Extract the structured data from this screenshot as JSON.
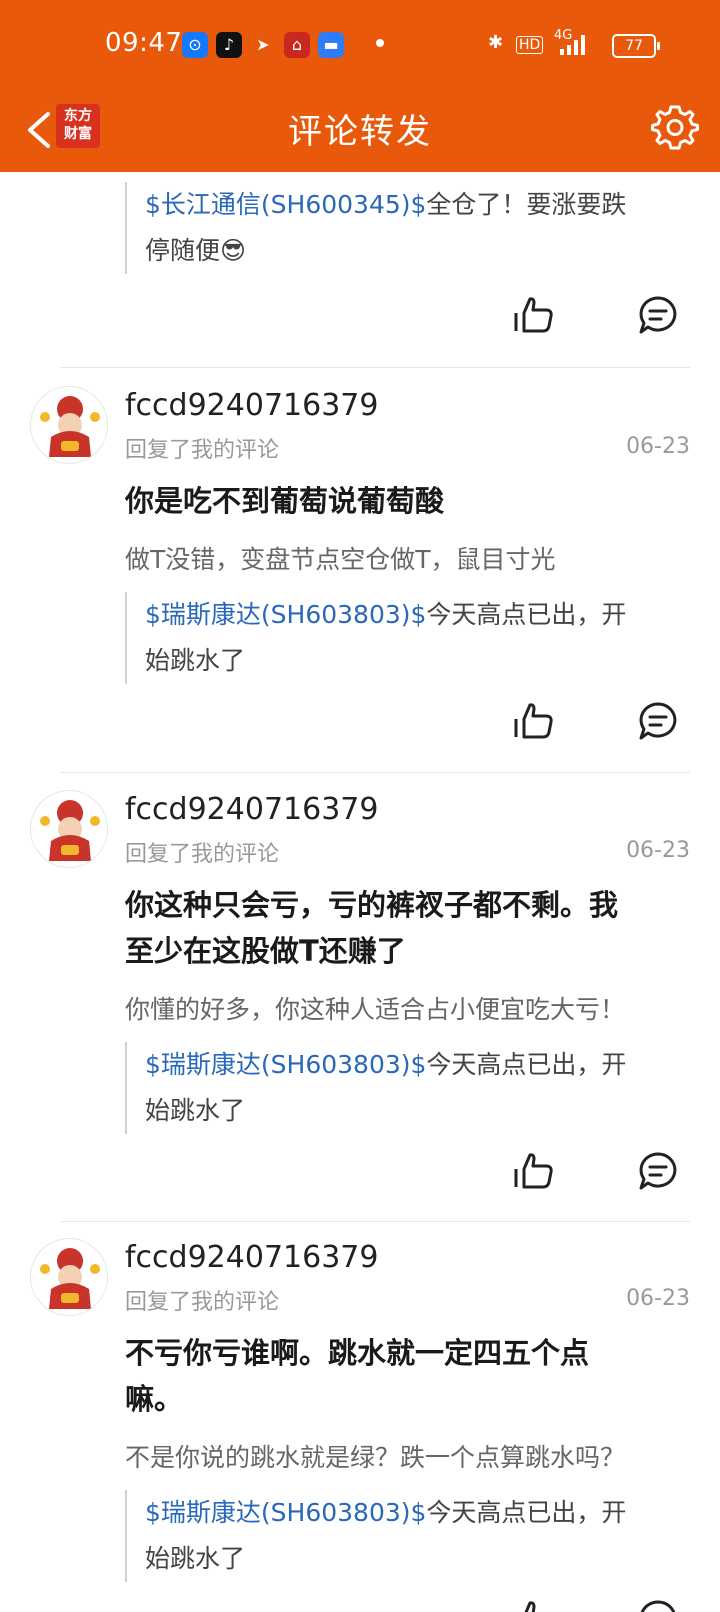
{
  "status_bar": {
    "time": "09:47",
    "network": "4G",
    "hd_label": "HD",
    "battery": "77",
    "app_icons": [
      "alipay-icon",
      "tiktok-icon",
      "telegram-icon",
      "app-icon",
      "wallet-icon"
    ]
  },
  "nav": {
    "title": "评论转发",
    "logo_line1": "东方",
    "logo_line2": "财富",
    "accent": "#e8590c"
  },
  "top_quote": {
    "stock": "$长江通信(SH600345)$",
    "text_line1": "全仓了！要涨要跌",
    "text_line2": "停随便",
    "emoji": "😎"
  },
  "comments": [
    {
      "username": "fccd9240716379",
      "action": "回复了我的评论",
      "date": "06-23",
      "title": "你是吃不到葡萄说葡萄酸",
      "original": "做T没错，变盘节点空仓做T，鼠目寸光",
      "quote_stock": "$瑞斯康达(SH603803)$",
      "quote_line1": "今天高点已出，开",
      "quote_line2": "始跳水了"
    },
    {
      "username": "fccd9240716379",
      "action": "回复了我的评论",
      "date": "06-23",
      "title_line1": "你这种只会亏，亏的裤衩子都不剩。我",
      "title_line2": "至少在这股做T还赚了",
      "original": "你懂的好多，你这种人适合占小便宜吃大亏！",
      "quote_stock": "$瑞斯康达(SH603803)$",
      "quote_line1": "今天高点已出，开",
      "quote_line2": "始跳水了"
    },
    {
      "username": "fccd9240716379",
      "action": "回复了我的评论",
      "date": "06-23",
      "title_line1": "不亏你亏谁啊。跳水就一定四五个点",
      "title_line2": "嘛。",
      "original": "不是你说的跳水就是绿？跌一个点算跳水吗？",
      "quote_stock": "$瑞斯康达(SH603803)$",
      "quote_line1": "今天高点已出，开",
      "quote_line2": "始跳水了"
    }
  ]
}
